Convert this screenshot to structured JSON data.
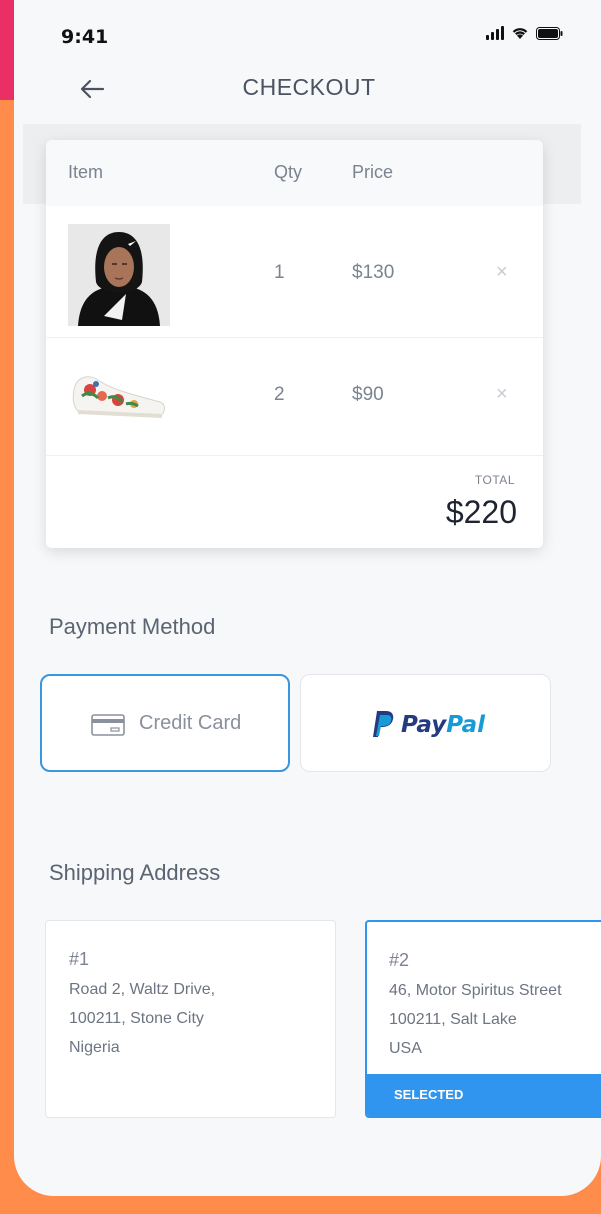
{
  "status_bar": {
    "time": "9:41"
  },
  "header": {
    "title": "CHECKOUT"
  },
  "cart": {
    "columns": {
      "item": "Item",
      "qty": "Qty",
      "price": "Price"
    },
    "rows": [
      {
        "qty": "1",
        "price": "$130"
      },
      {
        "qty": "2",
        "price": "$90"
      }
    ],
    "total_label": "TOTAL",
    "total_value": "$220"
  },
  "payment": {
    "title": "Payment Method",
    "credit_card_label": "Credit Card",
    "paypal_pay": "Pay",
    "paypal_pal": "Pal"
  },
  "shipping": {
    "title": "Shipping Address",
    "addresses": [
      {
        "number": "#1",
        "line1": "Road 2, Waltz Drive,",
        "line2": "100211, Stone City",
        "line3": "Nigeria"
      },
      {
        "number": "#2",
        "line1": "46, Motor Spiritus Street",
        "line2": "100211, Salt Lake",
        "line3": "USA",
        "badge": "SELECTED"
      }
    ]
  },
  "colors": {
    "background": "#ff8c4b",
    "accent_strip": "#ea2f66",
    "primary": "#2f95ee",
    "paypal_dark": "#253b80",
    "paypal_light": "#179bd7"
  }
}
